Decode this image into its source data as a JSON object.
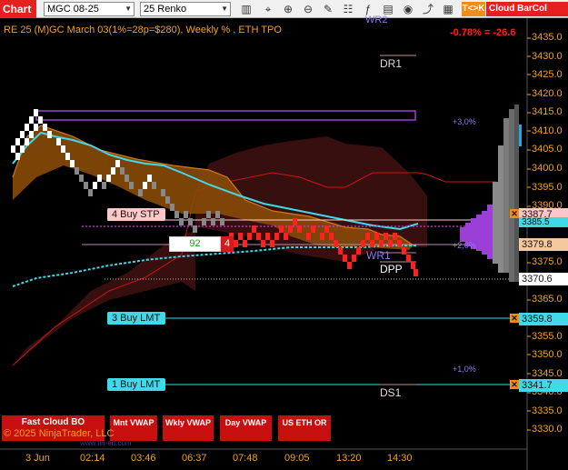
{
  "toolbar": {
    "chart_label": "Chart",
    "instrument": "MGC 08-25",
    "bar_type": "25 Renko",
    "tk_label": "T<>K",
    "cloud_label": "Cloud BarCol"
  },
  "chart": {
    "title": "RE 25 (M)GC March 03(1%=28p=$280), Weekly % , ETH TPO",
    "change_text": "-0.78% = -26.6",
    "levels": {
      "wr2": "WR2",
      "dr1": "DR1",
      "wr1": "WR1",
      "dpp": "DPP",
      "ds1": "DS1"
    },
    "orders": {
      "buy_stp": "4 Buy STP",
      "buy_lmt_3": "3 Buy LMT",
      "buy_lmt_1": "1 Buy LMT",
      "position_qty": "92",
      "position_red": "4"
    },
    "pct_marks": {
      "p3": "+3,0%",
      "p2": "+2,0%",
      "p1": "+1,0%"
    },
    "price_axis": [
      "3435.0",
      "3430.0",
      "3425.0",
      "3420.0",
      "3415.0",
      "3410.0",
      "3405.0",
      "3400.0",
      "3395.0",
      "3390.0",
      "3385.0",
      "3380.0",
      "3375.0",
      "3370.0",
      "3365.0",
      "3360.0",
      "3355.0",
      "3350.0",
      "3345.0",
      "3340.0",
      "3335.0",
      "3330.0"
    ],
    "price_flags": {
      "stp": "3387.7",
      "cyan_line": "3385.5",
      "last": "3379.8",
      "dotted": "3370.6",
      "lmt3": "3359.8",
      "lmt1": "3341.7"
    },
    "time_axis": [
      "3 Jun",
      "02:14",
      "03:46",
      "06:37",
      "07:48",
      "09:05",
      "13:20",
      "14:30"
    ],
    "copyright": "© 2025 NinjaTrader, LLC",
    "website": "www.fin-ed.com"
  },
  "bottom_buttons": {
    "fast_cloud": "Fast Cloud BO",
    "mnt_vwap": "Mnt VWAP",
    "wkly_vwap": "Wkly VWAP",
    "day_vwap": "Day VWAP",
    "us_eth_or": "US ETH OR"
  },
  "colors": {
    "accent_orange": "#f2a21f",
    "up_bar": "#ffffff",
    "down_bar": "#ff2020",
    "cyan": "#3fd9e8",
    "purple": "#9b3fd6",
    "button_red": "#c80f0f"
  }
}
